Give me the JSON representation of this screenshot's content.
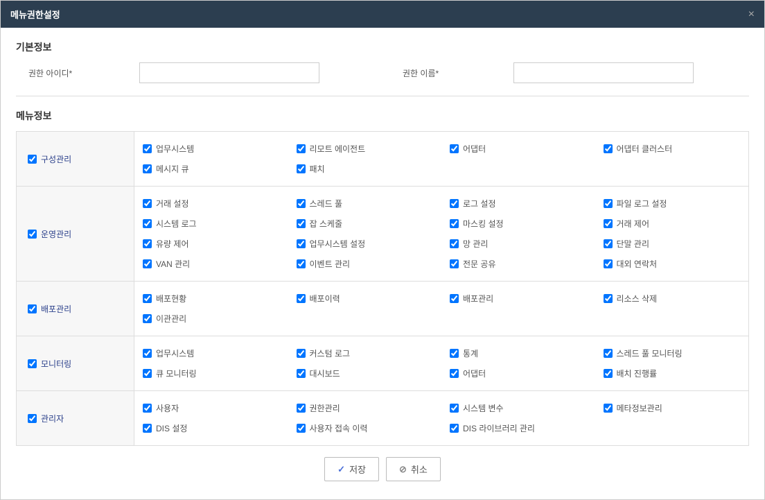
{
  "modal": {
    "title": "메뉴권한설정",
    "close": "×"
  },
  "basicInfo": {
    "title": "기본정보",
    "idLabel": "권한 아이디*",
    "nameLabel": "권한 이름*",
    "idValue": "",
    "nameValue": ""
  },
  "menuInfo": {
    "title": "메뉴정보",
    "groups": [
      {
        "label": "구성관리",
        "items": [
          "업무시스템",
          "리모트 에이전트",
          "어댑터",
          "어댑터 클러스터",
          "메시지 큐",
          "패치"
        ]
      },
      {
        "label": "운영관리",
        "items": [
          "거래 설정",
          "스레드 풀",
          "로그 설정",
          "파일 로그 설정",
          "시스템 로그",
          "잡 스케줄",
          "마스킹 설정",
          "거래 제어",
          "유량 제어",
          "업무시스템 설정",
          "망 관리",
          "단말 관리",
          "VAN 관리",
          "이벤트 관리",
          "전문 공유",
          "대외 연락처"
        ]
      },
      {
        "label": "배포관리",
        "items": [
          "배포현황",
          "배포이력",
          "배포관리",
          "리소스 삭제",
          "이관관리"
        ]
      },
      {
        "label": "모니터링",
        "items": [
          "업무시스템",
          "커스텀 로그",
          "통계",
          "스레드 풀 모니터링",
          "큐 모니터링",
          "대시보드",
          "어댑터",
          "배치 진행률"
        ]
      },
      {
        "label": "관리자",
        "items": [
          "사용자",
          "권한관리",
          "시스템 변수",
          "메타정보관리",
          "DIS 설정",
          "사용자 접속 이력",
          "DIS 라이브러리 관리"
        ]
      }
    ]
  },
  "footer": {
    "save": "저장",
    "cancel": "취소"
  }
}
